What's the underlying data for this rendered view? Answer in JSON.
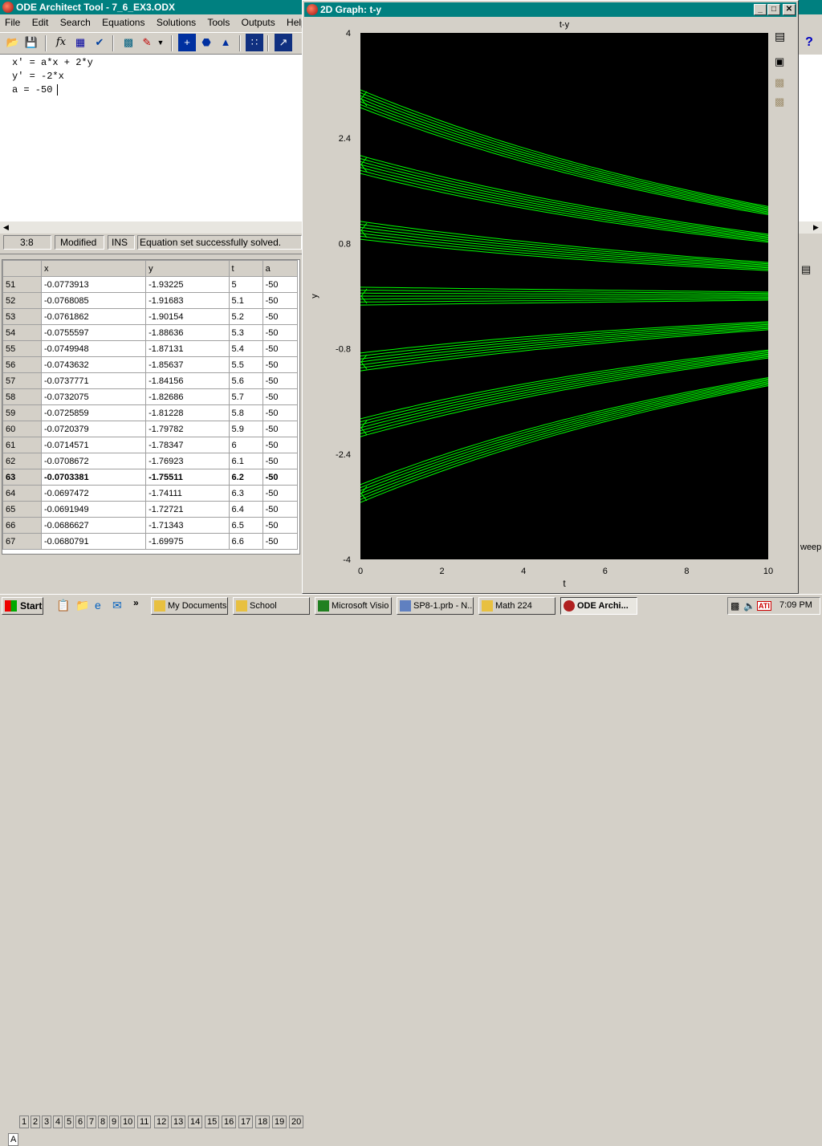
{
  "main_window": {
    "title": "ODE Architect Tool - 7_6_EX3.ODX",
    "menu": [
      "File",
      "Edit",
      "Search",
      "Equations",
      "Solutions",
      "Tools",
      "Outputs",
      "Help"
    ],
    "equations": [
      "x' = a*x + 2*y",
      "y' = -2*x",
      "a = -50"
    ],
    "status": {
      "position": "3:8",
      "state": "Modified",
      "mode": "INS",
      "message": "Equation set successfully solved."
    },
    "table": {
      "headers": [
        "x",
        "y",
        "t",
        "a"
      ],
      "rows": [
        [
          "51",
          "-0.0773913",
          "-1.93225",
          "5",
          "-50"
        ],
        [
          "52",
          "-0.0768085",
          "-1.91683",
          "5.1",
          "-50"
        ],
        [
          "53",
          "-0.0761862",
          "-1.90154",
          "5.2",
          "-50"
        ],
        [
          "54",
          "-0.0755597",
          "-1.88636",
          "5.3",
          "-50"
        ],
        [
          "55",
          "-0.0749948",
          "-1.87131",
          "5.4",
          "-50"
        ],
        [
          "56",
          "-0.0743632",
          "-1.85637",
          "5.5",
          "-50"
        ],
        [
          "57",
          "-0.0737771",
          "-1.84156",
          "5.6",
          "-50"
        ],
        [
          "58",
          "-0.0732075",
          "-1.82686",
          "5.7",
          "-50"
        ],
        [
          "59",
          "-0.0725859",
          "-1.81228",
          "5.8",
          "-50"
        ],
        [
          "60",
          "-0.0720379",
          "-1.79782",
          "5.9",
          "-50"
        ],
        [
          "61",
          "-0.0714571",
          "-1.78347",
          "6",
          "-50"
        ],
        [
          "62",
          "-0.0708672",
          "-1.76923",
          "6.1",
          "-50"
        ],
        [
          "63",
          "-0.0703381",
          "-1.75511",
          "6.2",
          "-50"
        ],
        [
          "64",
          "-0.0697472",
          "-1.74111",
          "6.3",
          "-50"
        ],
        [
          "65",
          "-0.0691949",
          "-1.72721",
          "6.4",
          "-50"
        ],
        [
          "66",
          "-0.0686627",
          "-1.71343",
          "6.5",
          "-50"
        ],
        [
          "67",
          "-0.0680791",
          "-1.69975",
          "6.6",
          "-50"
        ]
      ],
      "bold_row": "63"
    },
    "tabs": [
      "A",
      "1",
      "2",
      "3",
      "4",
      "5",
      "6",
      "7",
      "8",
      "9",
      "10",
      "11",
      "12",
      "13",
      "14",
      "15",
      "16",
      "17",
      "18",
      "19",
      "20"
    ],
    "right_edge_text": "weep"
  },
  "graph_window": {
    "title": "2D Graph: t-y",
    "chart_data": {
      "type": "line",
      "title": "t-y",
      "xlabel": "t",
      "ylabel": "y",
      "xlim": [
        0,
        10
      ],
      "ylim": [
        -4,
        4
      ],
      "xticks": [
        "0",
        "2",
        "4",
        "6",
        "8",
        "10"
      ],
      "yticks": [
        "4",
        "2.4",
        "0.8",
        "-0.8",
        "-2.4",
        "-4"
      ],
      "series": [
        {
          "values_t": [
            0,
            10
          ],
          "start": 3.0,
          "end": 1.3
        },
        {
          "values_t": [
            0,
            10
          ],
          "start": 2.0,
          "end": 0.88
        },
        {
          "values_t": [
            0,
            10
          ],
          "start": 1.0,
          "end": 0.45
        },
        {
          "values_t": [
            0,
            10
          ],
          "start": 0.0,
          "end": 0.0
        },
        {
          "values_t": [
            0,
            10
          ],
          "start": -1.0,
          "end": -0.45
        },
        {
          "values_t": [
            0,
            10
          ],
          "start": -2.0,
          "end": -0.88
        },
        {
          "values_t": [
            0,
            10
          ],
          "start": -3.0,
          "end": -1.3
        }
      ],
      "line_color": "#00ff00",
      "background": "#000000"
    }
  },
  "taskbar": {
    "start": "Start",
    "items": [
      "My Documents",
      "School",
      "Microsoft Visio",
      "SP8-1.prb - N...",
      "Math 224",
      "ODE Archi..."
    ],
    "clock": "7:09 PM"
  }
}
